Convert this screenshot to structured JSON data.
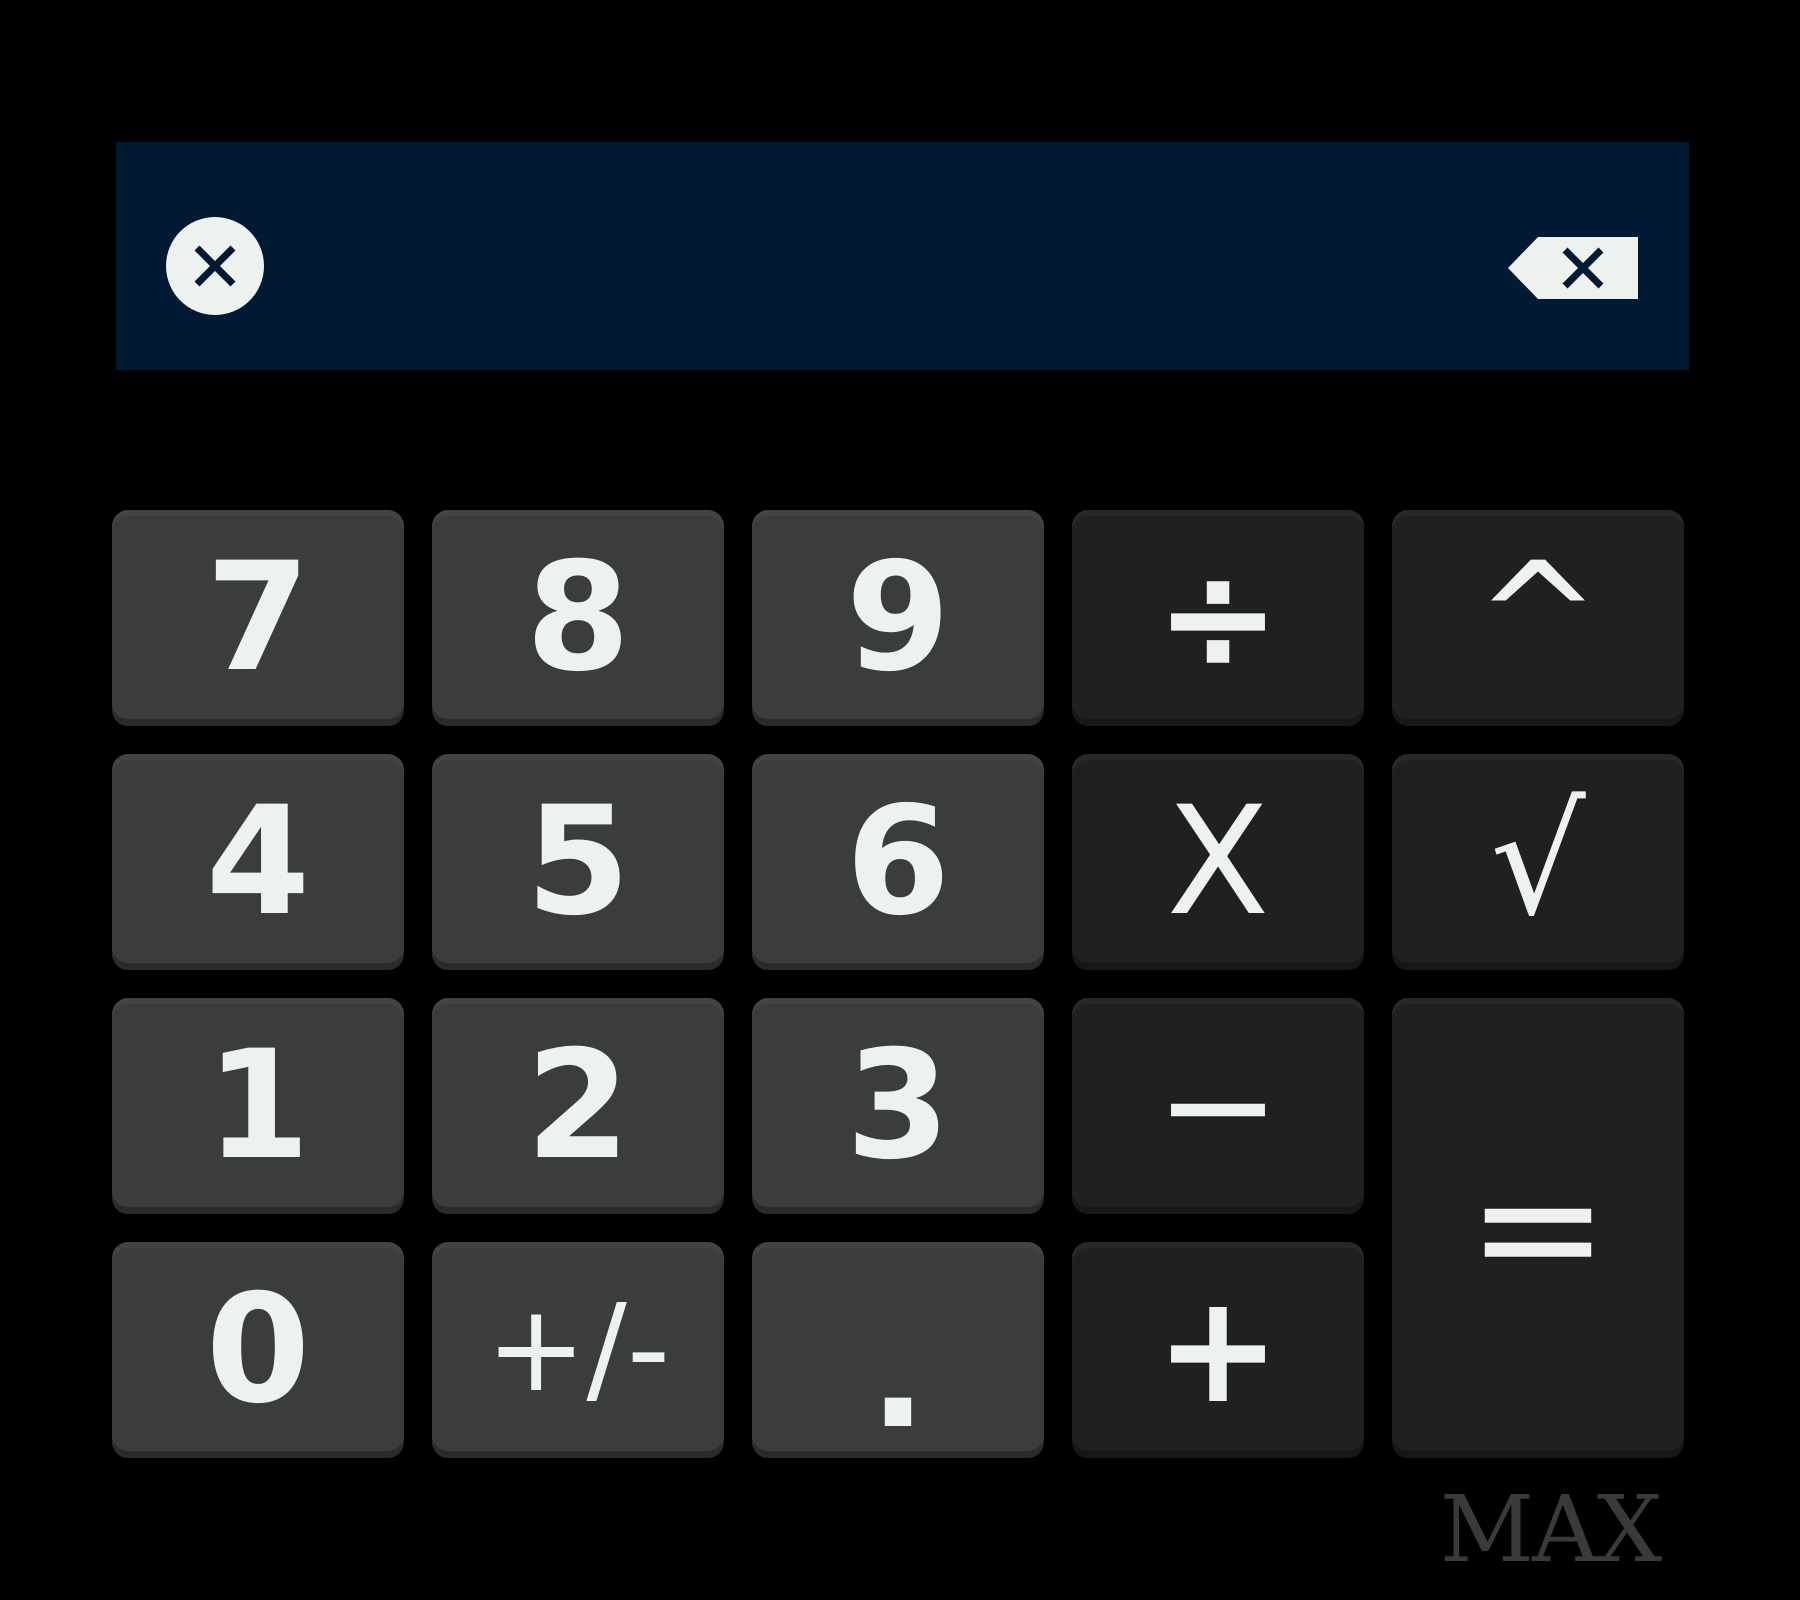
{
  "display": {
    "value": "",
    "clear_icon": "clear-circle-icon",
    "backspace_icon": "backspace-icon",
    "background": "#001a33"
  },
  "keypad": {
    "keys": {
      "seven": "7",
      "eight": "8",
      "nine": "9",
      "divide": "÷",
      "power": "^",
      "four": "4",
      "five": "5",
      "six": "6",
      "multiply": "X",
      "sqrt": "√",
      "one": "1",
      "two": "2",
      "three": "3",
      "minus": "−",
      "equals": "=",
      "zero": "0",
      "plus_minus": "+/-",
      "decimal": ".",
      "plus": "+"
    },
    "colors": {
      "number_key": "#3b3d3a",
      "operator_key": "#202020",
      "key_text": "#eef2ee"
    }
  },
  "brand": {
    "label": "MAX"
  }
}
